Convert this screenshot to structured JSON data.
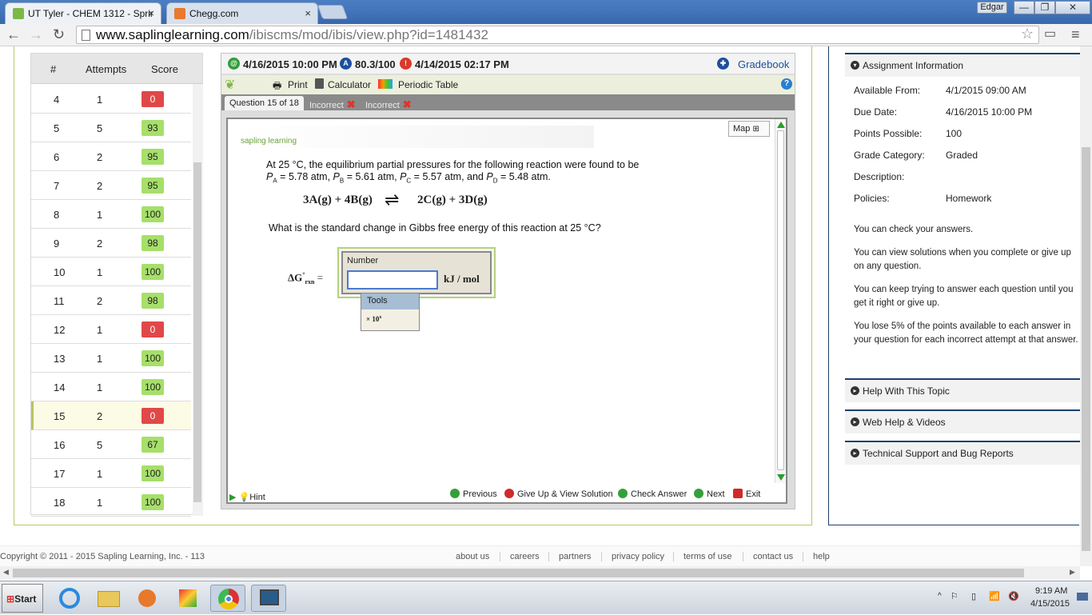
{
  "browser": {
    "tabs": [
      {
        "title": "UT Tyler - CHEM 1312 - Sprir",
        "close": "×"
      },
      {
        "title": "Chegg.com",
        "close": "×"
      }
    ],
    "user": "Edgar",
    "window_buttons": [
      "—",
      "❐",
      "✕"
    ],
    "url_host": "www.saplinglearning.com",
    "url_path": "/ibiscms/mod/ibis/view.php?id=1481432"
  },
  "score_table": {
    "headers": {
      "num": "#",
      "attempts": "Attempts",
      "score": "Score"
    },
    "rows": [
      {
        "num": "4",
        "attempts": "1",
        "score": "0",
        "status": "red"
      },
      {
        "num": "5",
        "attempts": "5",
        "score": "93",
        "status": "green"
      },
      {
        "num": "6",
        "attempts": "2",
        "score": "95",
        "status": "green"
      },
      {
        "num": "7",
        "attempts": "2",
        "score": "95",
        "status": "green"
      },
      {
        "num": "8",
        "attempts": "1",
        "score": "100",
        "status": "green"
      },
      {
        "num": "9",
        "attempts": "2",
        "score": "98",
        "status": "green"
      },
      {
        "num": "10",
        "attempts": "1",
        "score": "100",
        "status": "green"
      },
      {
        "num": "11",
        "attempts": "2",
        "score": "98",
        "status": "green"
      },
      {
        "num": "12",
        "attempts": "1",
        "score": "0",
        "status": "red"
      },
      {
        "num": "13",
        "attempts": "1",
        "score": "100",
        "status": "green"
      },
      {
        "num": "14",
        "attempts": "1",
        "score": "100",
        "status": "green"
      },
      {
        "num": "15",
        "attempts": "2",
        "score": "0",
        "status": "red",
        "current": true
      },
      {
        "num": "16",
        "attempts": "5",
        "score": "67",
        "status": "green"
      },
      {
        "num": "17",
        "attempts": "1",
        "score": "100",
        "status": "green"
      },
      {
        "num": "18",
        "attempts": "1",
        "score": "100",
        "status": "green"
      }
    ]
  },
  "question_panel": {
    "due": "4/16/2015 10:00 PM",
    "grade": "80.3/100",
    "late": "4/14/2015 02:17 PM",
    "gradebook": "Gradebook",
    "tools": {
      "print": "Print",
      "calculator": "Calculator",
      "periodic": "Periodic Table",
      "help": "?"
    },
    "tabs": {
      "current": "Question 15 of 18",
      "attempt1": "Incorrect",
      "attempt2": "Incorrect"
    },
    "map": "Map",
    "logo": "sapling learning",
    "text_line1": "At 25 °C, the equilibrium partial pressures for the following reaction were found to be",
    "pressures": {
      "pa": "5.78 atm",
      "pb": "5.61 atm",
      "pc": "5.57 atm",
      "pd": "5.48 atm"
    },
    "equation_left": "3A(g) + 4B(g)",
    "equation_arrow": "⇌",
    "equation_right": "2C(g) + 3D(g)",
    "question": "What is the standard change in Gibbs free energy of this reaction at 25 °C?",
    "answer_label": "Number",
    "answer_value": "",
    "unit": "kJ / mol",
    "tools_label": "Tools",
    "tools_sci": "× 10",
    "nav": {
      "hint": "Hint",
      "previous": "Previous",
      "giveup": "Give Up & View Solution",
      "check": "Check Answer",
      "next": "Next",
      "exit": "Exit"
    }
  },
  "assignment_info": {
    "header": "Assignment Information",
    "fields": [
      {
        "label": "Available From:",
        "value": "4/1/2015 09:00 AM"
      },
      {
        "label": "Due Date:",
        "value": "4/16/2015 10:00 PM"
      },
      {
        "label": "Points Possible:",
        "value": "100"
      },
      {
        "label": "Grade Category:",
        "value": "Graded"
      },
      {
        "label": "Description:",
        "value": ""
      },
      {
        "label": "Policies:",
        "value": "Homework"
      }
    ],
    "policies": [
      "You can check your answers.",
      "You can view solutions when you complete or give up on any question.",
      "You can keep trying to answer each question until you get it right or give up.",
      "You lose 5% of the points available to each answer in your question for each incorrect attempt at that answer."
    ],
    "sections": [
      "Help With This Topic",
      "Web Help & Videos",
      "Technical Support and Bug Reports"
    ]
  },
  "footer": {
    "copyright": "Copyright © 2011 - 2015 Sapling Learning, Inc. - 113",
    "links": [
      "about us",
      "careers",
      "partners",
      "privacy policy",
      "terms of use",
      "contact us",
      "help"
    ]
  },
  "taskbar": {
    "start": "Start",
    "time": "9:19 AM",
    "date": "4/15/2015"
  },
  "colors": {
    "correct": "#a6df6a",
    "incorrect": "#e04848",
    "accent": "#1d3f6e"
  }
}
